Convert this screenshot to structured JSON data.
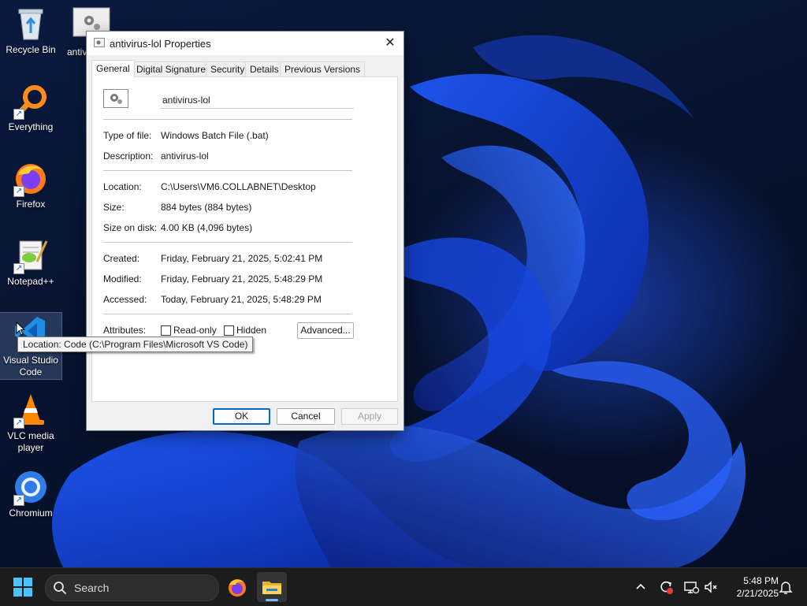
{
  "desktop": {
    "icons": [
      {
        "label": "Recycle Bin"
      },
      {
        "label": "antivirus-lol"
      },
      {
        "label": "Everything"
      },
      {
        "label": "Firefox"
      },
      {
        "label": "Notepad++"
      },
      {
        "label": "Visual Studio Code"
      },
      {
        "label": "VLC media player"
      },
      {
        "label": "Chromium"
      }
    ],
    "tooltip": "Location: Code (C:\\Program Files\\Microsoft VS Code)"
  },
  "dialog": {
    "title": "antivirus-lol Properties",
    "close_glyph": "✕",
    "tabs": [
      "General",
      "Digital Signatures",
      "Security",
      "Details",
      "Previous Versions"
    ],
    "active_tab": "General",
    "file_name": "antivirus-lol",
    "fields": {
      "type_label": "Type of file:",
      "type_value": "Windows Batch File (.bat)",
      "description_label": "Description:",
      "description_value": "antivirus-lol",
      "location_label": "Location:",
      "location_value": "C:\\Users\\VM6.COLLABNET\\Desktop",
      "size_label": "Size:",
      "size_value": "884 bytes (884 bytes)",
      "size_on_disk_label": "Size on disk:",
      "size_on_disk_value": "4.00 KB (4,096 bytes)",
      "created_label": "Created:",
      "created_value": "Friday, February 21, 2025, 5:02:41 PM",
      "modified_label": "Modified:",
      "modified_value": "Friday, February 21, 2025, 5:48:29 PM",
      "accessed_label": "Accessed:",
      "accessed_value": "Today, February 21, 2025, 5:48:29 PM",
      "attributes_label": "Attributes:"
    },
    "attributes": {
      "readonly_label": "Read-only",
      "readonly_checked": false,
      "hidden_label": "Hidden",
      "hidden_checked": false,
      "advanced_label": "Advanced..."
    },
    "buttons": {
      "ok": "OK",
      "cancel": "Cancel",
      "apply": "Apply"
    }
  },
  "taskbar": {
    "search_placeholder": "Search",
    "clock_time": "5:48 PM",
    "clock_date": "2/21/2025",
    "accent_color": "#0067c0"
  }
}
